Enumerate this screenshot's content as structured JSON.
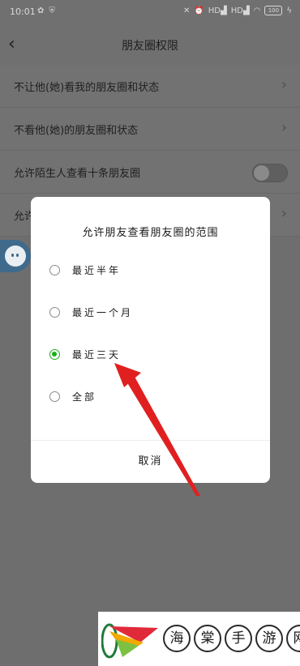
{
  "status_bar": {
    "time": "10:01",
    "battery": "100",
    "network_tags": [
      "HD",
      "HD"
    ],
    "icons": [
      "notification-icon",
      "shield-app-icon",
      "mute-icon",
      "alarm-icon",
      "signal-icon",
      "signal-icon",
      "wifi-icon",
      "battery-icon",
      "charging-icon"
    ]
  },
  "nav": {
    "back_icon": "chevron-left-icon",
    "title": "朋友圈权限"
  },
  "settings": {
    "rows": [
      {
        "label": "不让他(她)看我的朋友圈和状态",
        "control": "chevron"
      },
      {
        "label": "不看他(她)的朋友圈和状态",
        "control": "chevron"
      },
      {
        "label": "允许陌生人查看十条朋友圈",
        "control": "toggle",
        "toggle_on": false
      },
      {
        "label": "允许",
        "control": "chevron"
      }
    ]
  },
  "dialog": {
    "title": "允许朋友查看朋友圈的范围",
    "options": [
      {
        "label": "最近半年",
        "selected": false
      },
      {
        "label": "最近一个月",
        "selected": false
      },
      {
        "label": "最近三天",
        "selected": true
      },
      {
        "label": "全部",
        "selected": false
      }
    ],
    "cancel_label": "取消",
    "accent_color": "#1aad19"
  },
  "watermark": {
    "chars": [
      "海",
      "棠",
      "手",
      "游",
      "网"
    ]
  }
}
